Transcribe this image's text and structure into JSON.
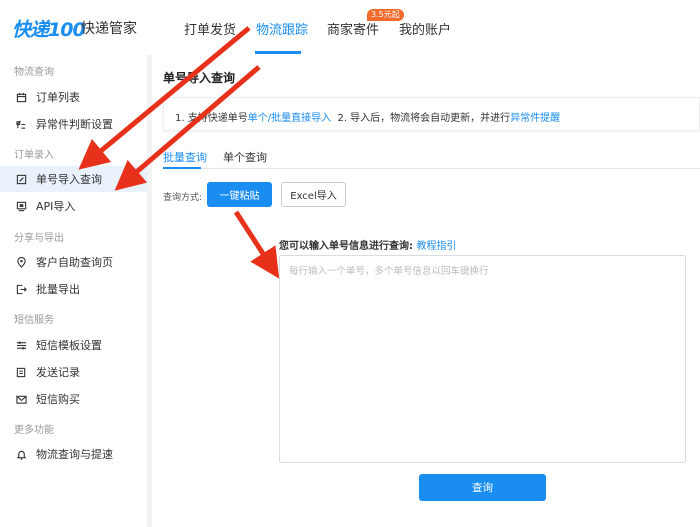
{
  "header": {
    "logo": "快递100",
    "logo_sub": "快递管家",
    "nav": [
      {
        "label": "打单发货"
      },
      {
        "label": "物流跟踪"
      },
      {
        "label": "商家寄件",
        "badge": "3.5元起"
      },
      {
        "label": "我的账户"
      }
    ]
  },
  "sidebar": {
    "groups": [
      {
        "title": "物流查询",
        "items": [
          {
            "label": "订单列表",
            "icon": "calendar-icon"
          },
          {
            "label": "异常件判断设置",
            "icon": "tune-icon"
          }
        ]
      },
      {
        "title": "订单录入",
        "items": [
          {
            "label": "单号导入查询",
            "icon": "edit-doc-icon"
          },
          {
            "label": "API导入",
            "icon": "api-icon"
          }
        ]
      },
      {
        "title": "分享与导出",
        "items": [
          {
            "label": "客户自助查询页",
            "icon": "location-icon"
          },
          {
            "label": "批量导出",
            "icon": "export-icon"
          }
        ]
      },
      {
        "title": "短信服务",
        "items": [
          {
            "label": "短信模板设置",
            "icon": "sliders-icon"
          },
          {
            "label": "发送记录",
            "icon": "record-icon"
          },
          {
            "label": "短信购买",
            "icon": "mail-icon"
          }
        ]
      },
      {
        "title": "更多功能",
        "items": [
          {
            "label": "物流查询与提速",
            "icon": "bell-icon"
          }
        ]
      }
    ]
  },
  "main": {
    "title": "单号导入查询",
    "notice": {
      "part1": "1. 支持快递单号",
      "link1": "单个/批量直接导入",
      "part2": "  2. 导入后，物流将会自动更新，并进行",
      "link2": "异常件提醒"
    },
    "tabs": [
      {
        "label": "批量查询"
      },
      {
        "label": "单个查询"
      }
    ],
    "query_label": "查询方式:",
    "btn_paste": "一键粘贴",
    "btn_excel": "Excel导入",
    "prompt": "您可以输入单号信息进行查询:",
    "prompt_link": "教程指引",
    "textarea_placeholder": "每行输入一个单号，多个单号信息以回车键换行",
    "submit": "查询"
  },
  "colors": {
    "accent": "#1a8df0",
    "annotation": "#e8311a",
    "badge": "#f26b2c"
  }
}
